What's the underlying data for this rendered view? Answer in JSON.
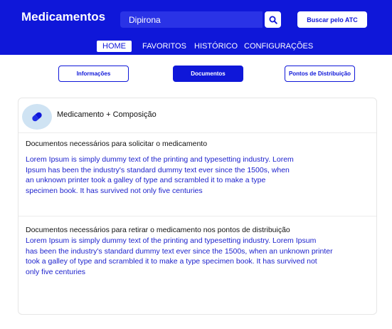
{
  "header": {
    "title": "Medicamentos",
    "search": {
      "value": "Dipirona",
      "placeholder": "Dipirona"
    },
    "search_icon": "search-icon",
    "atc_button": "Buscar pelo ATC"
  },
  "nav": {
    "items": [
      {
        "label": "HOME",
        "active": true
      },
      {
        "label": "FAVORITOS",
        "active": false
      },
      {
        "label": "HISTÓRICO",
        "active": false
      },
      {
        "label": "CONFIGURAÇÕES",
        "active": false
      }
    ]
  },
  "segments": {
    "items": [
      {
        "label": "Informações",
        "selected": false
      },
      {
        "label": "Documentos",
        "selected": true
      },
      {
        "label": "Pontos de Distribuição",
        "selected": false
      }
    ]
  },
  "card": {
    "icon": "pill-icon",
    "title": "Medicamento + Composição",
    "section1": {
      "heading": "Documentos necessários para solicitar o medicamento",
      "body_lines": [
        "Lorem Ipsum is simply dummy text of the printing and typesetting industry. Lorem",
        "Ipsum has been the industry's standard dummy text ever since the 1500s, when",
        "an unknown printer took a galley of type and scrambled it to make a type",
        "specimen book. It has survived not only five centuries"
      ]
    },
    "section2": {
      "heading": "Documentos necessários para retirar o medicamento  nos pontos de distribuição",
      "body_lines": [
        "Lorem Ipsum is simply dummy text of the printing and typesetting industry. Lorem Ipsum",
        "has been the industry's standard dummy text ever since the 1500s, when an unknown printer",
        "took a galley of type and scrambled it to make a type specimen book. It has survived not",
        "only five centuries"
      ]
    }
  },
  "colors": {
    "primary": "#0f17d9",
    "body_text": "#1a1fcc",
    "avatar_bg": "#cfe3f3"
  }
}
